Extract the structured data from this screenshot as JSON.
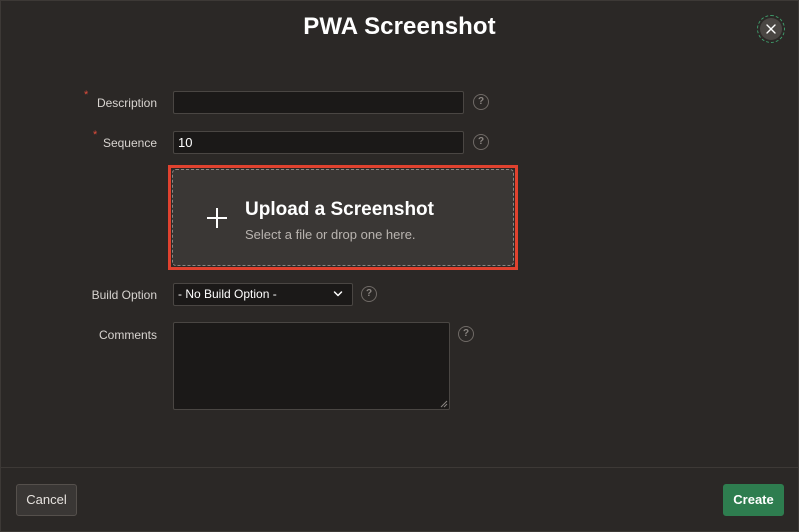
{
  "dialog": {
    "title": "PWA Screenshot",
    "close_icon": "close-icon"
  },
  "form": {
    "description": {
      "label": "Description",
      "required": true,
      "value": "",
      "help_icon": "question-icon"
    },
    "sequence": {
      "label": "Sequence",
      "required": true,
      "value": "10",
      "help_icon": "question-icon"
    },
    "upload": {
      "title": "Upload a Screenshot",
      "subtitle": "Select a file or drop one here.",
      "icon": "plus-icon",
      "highlight_color": "#e0422f"
    },
    "build_option": {
      "label": "Build Option",
      "selected": "- No Build Option -",
      "help_icon": "question-icon"
    },
    "comments": {
      "label": "Comments",
      "value": "",
      "help_icon": "question-icon"
    }
  },
  "footer": {
    "cancel_label": "Cancel",
    "create_label": "Create"
  },
  "colors": {
    "background": "#2b2826",
    "required_marker": "#e04c3c",
    "primary_button": "#2e7d4f"
  }
}
